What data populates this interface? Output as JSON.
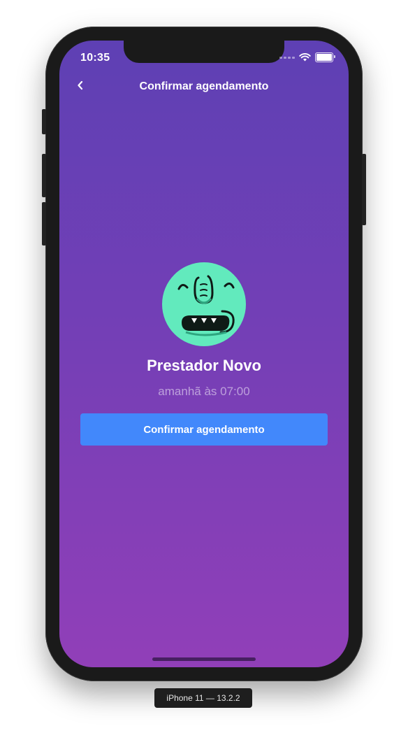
{
  "status_bar": {
    "time": "10:35"
  },
  "nav": {
    "title": "Confirmar agendamento",
    "back_icon": "chevron-left-icon"
  },
  "provider": {
    "avatar_icon": "monster-avatar",
    "name": "Prestador Novo",
    "appointment": "amanhã às 07:00"
  },
  "actions": {
    "confirm_label": "Confirmar agendamento"
  },
  "simulator": {
    "label": "iPhone 11 — 13.2.2"
  },
  "colors": {
    "gradient_top": "#5e40b4",
    "gradient_bottom": "#913fb8",
    "button": "#4288fb",
    "avatar_bg": "#62eabd"
  }
}
